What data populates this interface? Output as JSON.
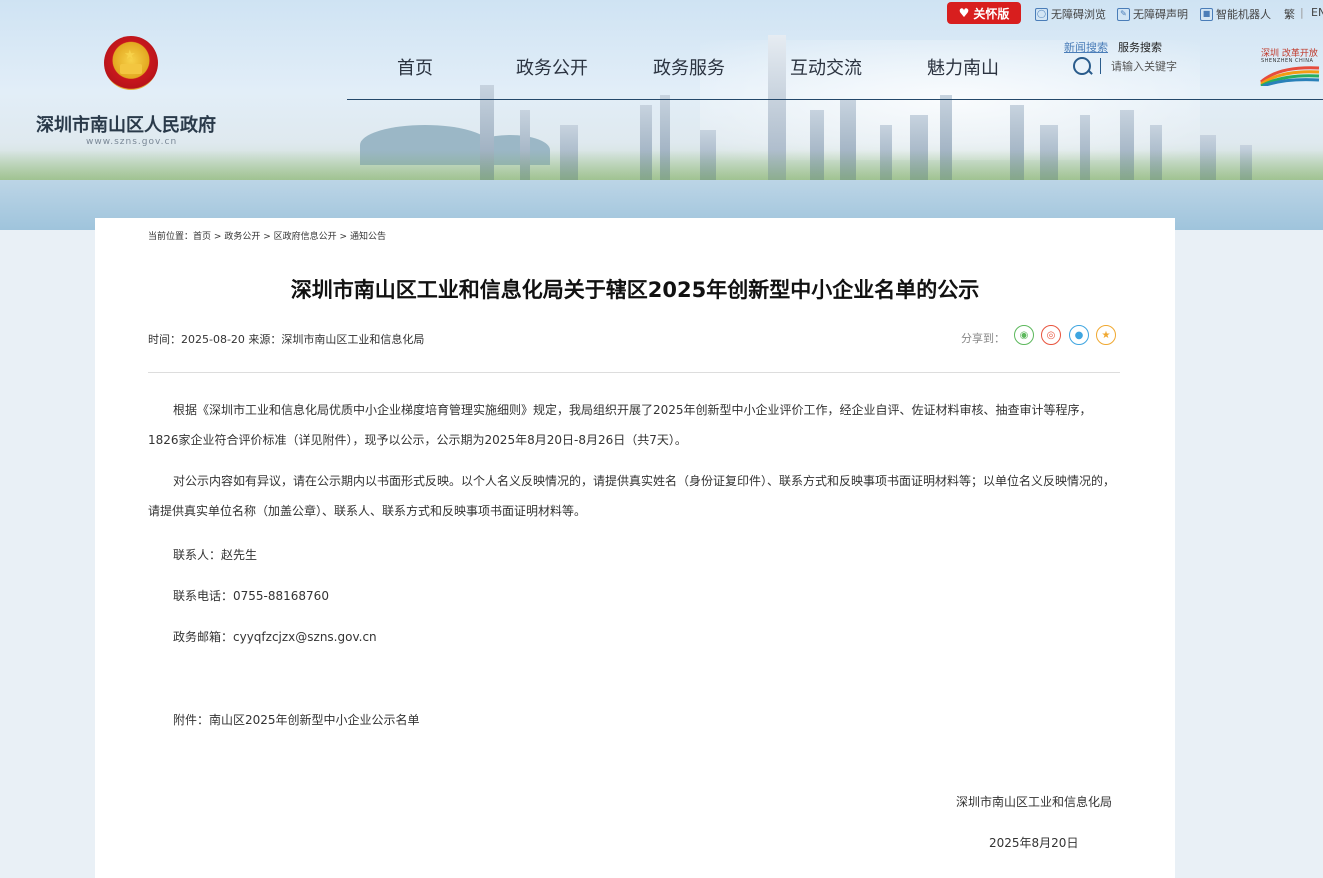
{
  "header": {
    "care_button": "关怀版",
    "util_links": [
      "无障碍浏览",
      "无障碍声明",
      "智能机器人",
      "繁",
      "EN"
    ],
    "site_name": "深圳市南山区人民政府",
    "site_url": "www.szns.gov.cn",
    "nav": [
      "首页",
      "政务公开",
      "政务服务",
      "互动交流",
      "魅力南山"
    ],
    "search": {
      "tab_news": "新闻搜索",
      "tab_service": "服务搜索",
      "placeholder": "请输入关键字"
    },
    "logo_text": "深圳 改革开放",
    "logo_sub": "SHENZHEN CHINA"
  },
  "breadcrumb": [
    "当前位置：",
    "首页",
    ">",
    "政务公开",
    ">",
    "区政府信息公开",
    ">",
    "通知公告"
  ],
  "article": {
    "title": "深圳市南山区工业和信息化局关于辖区2025年创新型中小企业名单的公示",
    "meta": "时间：2025-08-20  来源：深圳市南山区工业和信息化局",
    "share_label": "分享到：",
    "share_icons": [
      "wechat-icon",
      "weibo-icon",
      "qq-icon",
      "qzone-icon"
    ],
    "paragraphs": [
      "根据《深圳市工业和信息化局优质中小企业梯度培育管理实施细则》规定，我局组织开展了2025年创新型中小企业评价工作，经企业自评、佐证材料审核、抽查审计等程序，1826家企业符合评价标准（详见附件），现予以公示，公示期为2025年8月20日-8月26日（共7天）。",
      "对公示内容如有异议，请在公示期内以书面形式反映。以个人名义反映情况的，请提供真实姓名（身份证复印件）、联系方式和反映事项书面证明材料等；以单位名义反映情况的，请提供真实单位名称（加盖公章）、联系人、联系方式和反映事项书面证明材料等。"
    ],
    "contact": "联系人：赵先生",
    "phone": "联系电话：0755-88168760",
    "email": "政务邮箱：cyyqfzcjzx@szns.gov.cn",
    "attachment": "附件：南山区2025年创新型中小企业公示名单",
    "signature_org": "深圳市南山区工业和信息化局",
    "signature_date": "2025年8月20日"
  }
}
